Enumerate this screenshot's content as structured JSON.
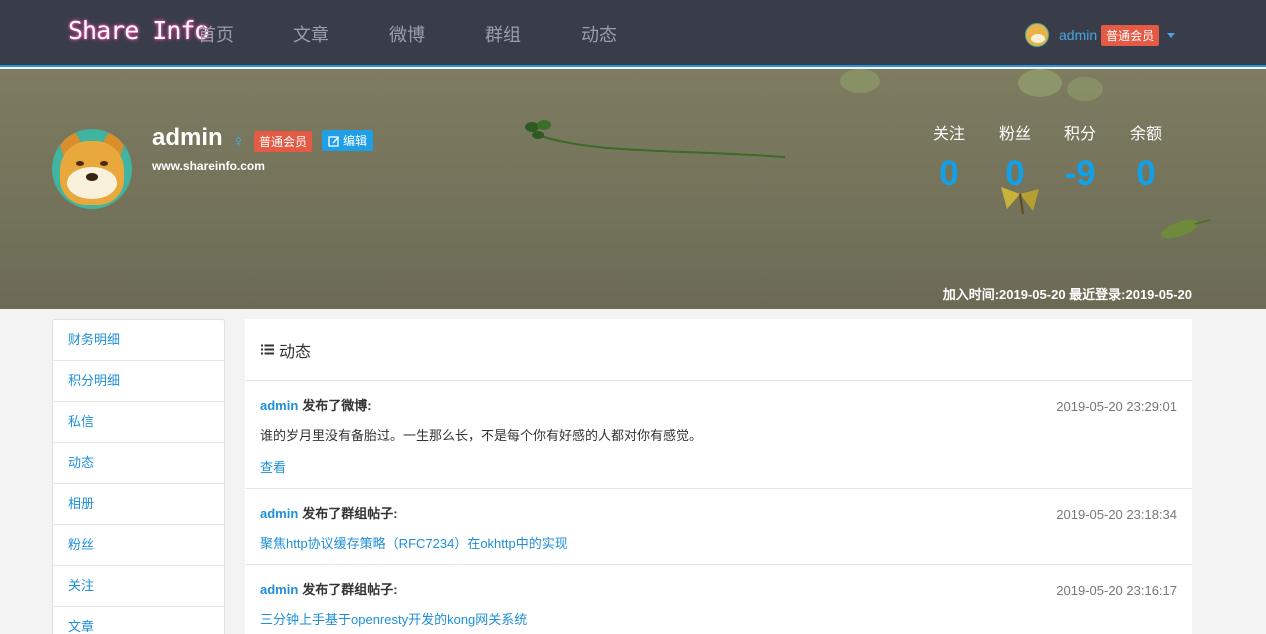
{
  "nav": {
    "brand": "Share Info",
    "items": [
      "首页",
      "文章",
      "微博",
      "群组",
      "动态"
    ],
    "username": "admin",
    "badge": "普通会员"
  },
  "profile": {
    "name": "admin",
    "gender_symbol": "♀",
    "badge": "普通会员",
    "edit_label": "编辑",
    "website": "www.shareinfo.com",
    "stats": [
      {
        "label": "关注",
        "value": "0"
      },
      {
        "label": "粉丝",
        "value": "0"
      },
      {
        "label": "积分",
        "value": "-9"
      },
      {
        "label": "余额",
        "value": "0"
      }
    ],
    "joined": "加入时间:2019-05-20 最近登录:2019-05-20"
  },
  "sidebar": {
    "items": [
      "财务明细",
      "积分明细",
      "私信",
      "动态",
      "相册",
      "粉丝",
      "关注",
      "文章"
    ]
  },
  "main": {
    "title": "动态",
    "feed": [
      {
        "user": "admin",
        "action": "发布了微博:",
        "time": "2019-05-20 23:29:01",
        "content": "谁的岁月里没有备胎过。一生那么长，不是每个你有好感的人都对你有感觉。",
        "view": "查看"
      },
      {
        "user": "admin",
        "action": "发布了群组帖子:",
        "time": "2019-05-20 23:18:34",
        "link": "聚焦http协议缓存策略（RFC7234）在okhttp中的实现"
      },
      {
        "user": "admin",
        "action": "发布了群组帖子:",
        "time": "2019-05-20 23:16:17",
        "link": "三分钟上手基于openresty开发的kong网关系统"
      }
    ]
  },
  "colors": {
    "navbar": "#393d49",
    "accent": "#1e8fd8",
    "badge": "#e45a44",
    "stat_number": "#12a0e8"
  }
}
